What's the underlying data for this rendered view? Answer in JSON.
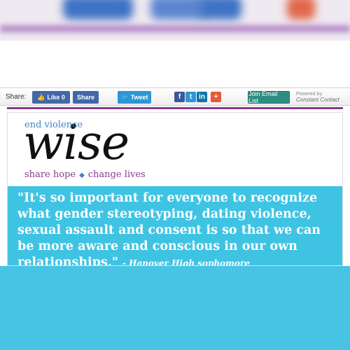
{
  "share_bar": {
    "label": "Share:",
    "like_button": "Like 0",
    "share_button": "Share",
    "tweet_button": "Tweet",
    "social_icons": [
      "facebook-icon",
      "twitter-icon",
      "linkedin-icon",
      "plus-icon"
    ],
    "email_button": "Join Email List",
    "powered_by": "Powered by",
    "powered_brand": "Constant Contact"
  },
  "logo": {
    "top_text": "end violence",
    "word": "wise",
    "bottom_left": "share hope",
    "bottom_right": "change lives"
  },
  "quote": {
    "text": "\"It's so important for everyone to recognize what gender stereotyping, dating violence, sexual assault and consent is so that we can be more aware and conscious in our own relationships.\"",
    "attribution": "- Hanover High sophomore"
  },
  "colors": {
    "purple": "#8b3a8f",
    "quote_bg": "#3fc3e3",
    "facebook": "#4367a8",
    "twitter": "#2d96d6",
    "email": "#2e8d83"
  }
}
